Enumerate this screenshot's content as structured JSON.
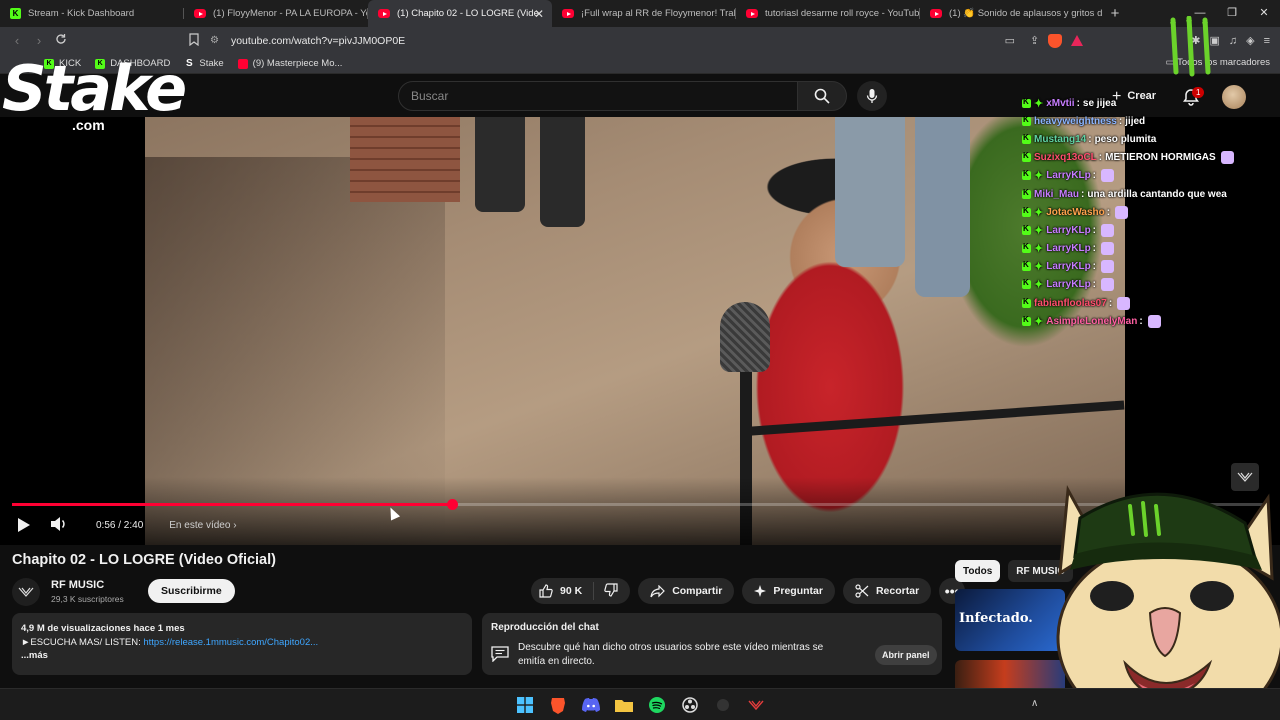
{
  "browser": {
    "tabs": [
      {
        "title": "Stream - Kick Dashboard",
        "favicon": "kick-icon"
      },
      {
        "title": "(1) FloyyMenor - PA LA EUROPA - Yo",
        "favicon": "youtube-icon"
      },
      {
        "title": "(1) Chapito 02 - LO LOGRE (Vide",
        "favicon": "youtube-icon",
        "active": true
      },
      {
        "title": "¡Full wrap al RR de Floyymenor! Trab",
        "favicon": "youtube-icon"
      },
      {
        "title": "tutoriasl desarme roll royce - YouTub",
        "favicon": "youtube-icon"
      },
      {
        "title": "(1) 👏 Sonido de aplausos y gritos d",
        "favicon": "youtube-icon"
      }
    ],
    "close_symbol": "✕",
    "new_tab_symbol": "+",
    "url": "youtube.com/watch?v=pivJJM0OP0E",
    "bookmarks": [
      {
        "label": "KICK",
        "icon": "kick-icon"
      },
      {
        "label": "DASHBOARD",
        "icon": "kick-icon"
      },
      {
        "label": "Stake",
        "icon": "stake-icon"
      },
      {
        "label": "(9) Masterpiece Mo...",
        "icon": "youtube-icon"
      }
    ],
    "all_bookmarks": "Todos los marcadores"
  },
  "youtube": {
    "search_placeholder": "Buscar",
    "create_label": "Crear",
    "notification_count": "1",
    "player": {
      "time": "0:56 / 2:40",
      "chapter": "En este vídeo",
      "progress_fraction": 0.35
    },
    "video_title": "Chapito 02 - LO LOGRE (Video Oficial)",
    "channel": {
      "name": "RF MUSIC",
      "subscribers": "29,3 K suscriptores"
    },
    "subscribe_label": "Suscribirme",
    "actions": {
      "likes": "90 K",
      "share": "Compartir",
      "ask": "Preguntar",
      "clip": "Recortar"
    },
    "description": {
      "meta": "4,9 M de visualizaciones  hace 1 mes",
      "line1_prefix": "►ESCUCHA MAS/ LISTEN: ",
      "link": "https://release.1mmusic.com/Chapito02...",
      "more": "...más"
    },
    "live_chat": {
      "title": "Reproducción del chat",
      "text": "Descubre qué han dicho otros usuarios sobre este vídeo mientras se emitía en directo.",
      "button": "Abrir panel"
    },
    "chips": [
      "Todos",
      "RF MUSIC"
    ],
    "recommendation_thumb_text": "Infectado."
  },
  "overlay": {
    "stake_word": "Stake",
    "stake_com": ".com",
    "chat": [
      {
        "user": "xMvtii",
        "color": "#c77dff",
        "text": "se jijea",
        "badge": "subscriber"
      },
      {
        "user": "heavyweightness",
        "color": "#8ab4ff",
        "text": "jijed",
        "badge": "kick"
      },
      {
        "user": "Mustang14",
        "color": "#5fd3a3",
        "text": "peso plumita",
        "badge": "kick"
      },
      {
        "user": "Suzixq13oCL",
        "color": "#ff4d6d",
        "text": "METIERON HORMIGAS",
        "badge": "kick",
        "emote": true
      },
      {
        "user": "LarryKLp",
        "color": "#c77dff",
        "text": "",
        "badge": "kick-sub",
        "emote": true
      },
      {
        "user": "Miki_Mau",
        "color": "#c77dff",
        "text": "una ardilla cantando que wea",
        "badge": "kick"
      },
      {
        "user": "JotacWasho",
        "color": "#ffa24c",
        "text": "",
        "badge": "kick-sub",
        "emote": true
      },
      {
        "user": "LarryKLp",
        "color": "#c77dff",
        "text": "",
        "badge": "kick-sub",
        "emote": true
      },
      {
        "user": "LarryKLp",
        "color": "#c77dff",
        "text": "",
        "badge": "kick-sub",
        "emote": true
      },
      {
        "user": "LarryKLp",
        "color": "#c77dff",
        "text": "",
        "badge": "kick-sub",
        "emote": true
      },
      {
        "user": "LarryKLp",
        "color": "#c77dff",
        "text": "",
        "badge": "kick-sub",
        "emote": true
      },
      {
        "user": "fabianfloolas07",
        "color": "#ff4d6d",
        "text": "",
        "badge": "kick",
        "emote": true
      },
      {
        "user": "AsimpleLonelyMan",
        "color": "#ff5fa2",
        "text": "",
        "badge": "kick-sub",
        "emote": true
      }
    ]
  },
  "colors": {
    "youtube_red": "#ff0033",
    "kick_green": "#53fc18",
    "link_blue": "#3ea6ff"
  }
}
